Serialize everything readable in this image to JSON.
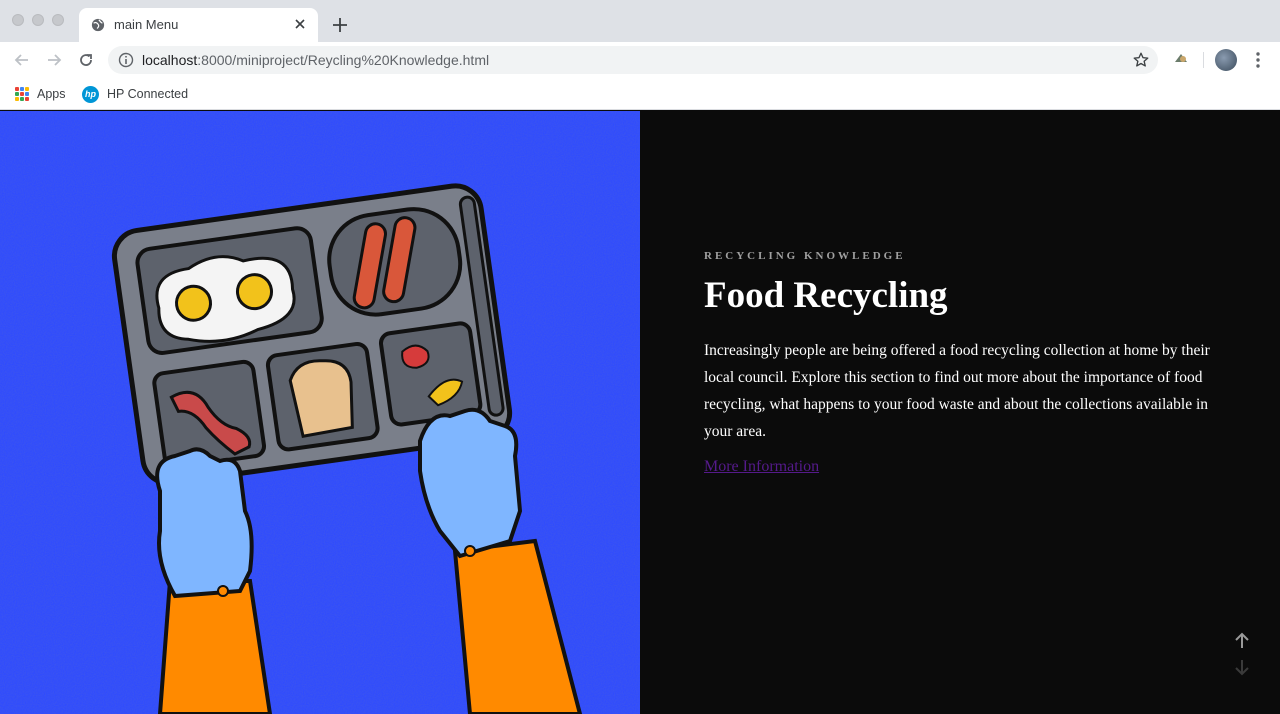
{
  "browser": {
    "tab": {
      "title": "main Menu"
    },
    "url": {
      "host": "localhost",
      "rest": ":8000/miniproject/Reycling%20Knowledge.html"
    },
    "bookmarks": [
      {
        "label": "Apps"
      },
      {
        "label": "HP Connected"
      }
    ]
  },
  "hero": {
    "eyebrow": "RECYCLING KNOWLEDGE",
    "title": "Food Recycling",
    "body": "Increasingly people are being offered a food recycling collection at home by their local council. Explore this section to find out more about the importance of food recycling, what happens to your food waste and about the collections available in your area.",
    "link": "More Information"
  },
  "colors": {
    "background": "#0b0b0b",
    "image_blue": "#2f4bff",
    "link_visited": "#551a8b"
  },
  "icons": {
    "scroll_up": "arrow-up-icon",
    "scroll_down": "arrow-down-icon"
  }
}
